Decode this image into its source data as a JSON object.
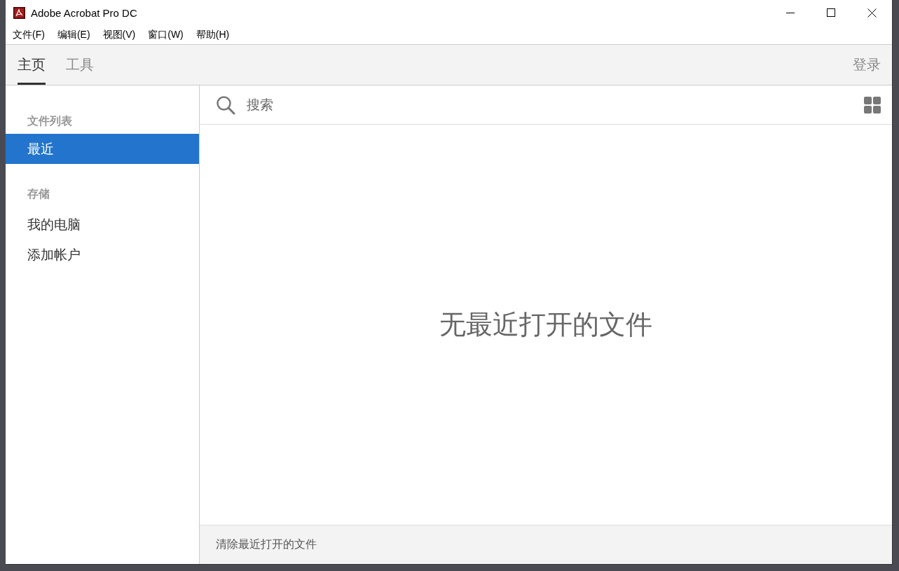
{
  "window": {
    "title": "Adobe Acrobat Pro DC"
  },
  "menu": [
    "文件(F)",
    "编辑(E)",
    "视图(V)",
    "窗口(W)",
    "帮助(H)"
  ],
  "tabs": [
    {
      "label": "主页",
      "selected": true
    },
    {
      "label": "工具",
      "selected": false
    }
  ],
  "sign_in": "登录",
  "sidebar": {
    "sections": [
      {
        "heading": "文件列表",
        "items": [
          {
            "label": "最近",
            "selected": true
          }
        ]
      },
      {
        "heading": "存储",
        "items": [
          {
            "label": "我的电脑",
            "selected": false
          },
          {
            "label": "添加帐户",
            "selected": false
          }
        ]
      }
    ]
  },
  "search": {
    "placeholder": "搜索"
  },
  "empty_message": "无最近打开的文件",
  "footer": {
    "link": "清除最近打开的文件"
  }
}
